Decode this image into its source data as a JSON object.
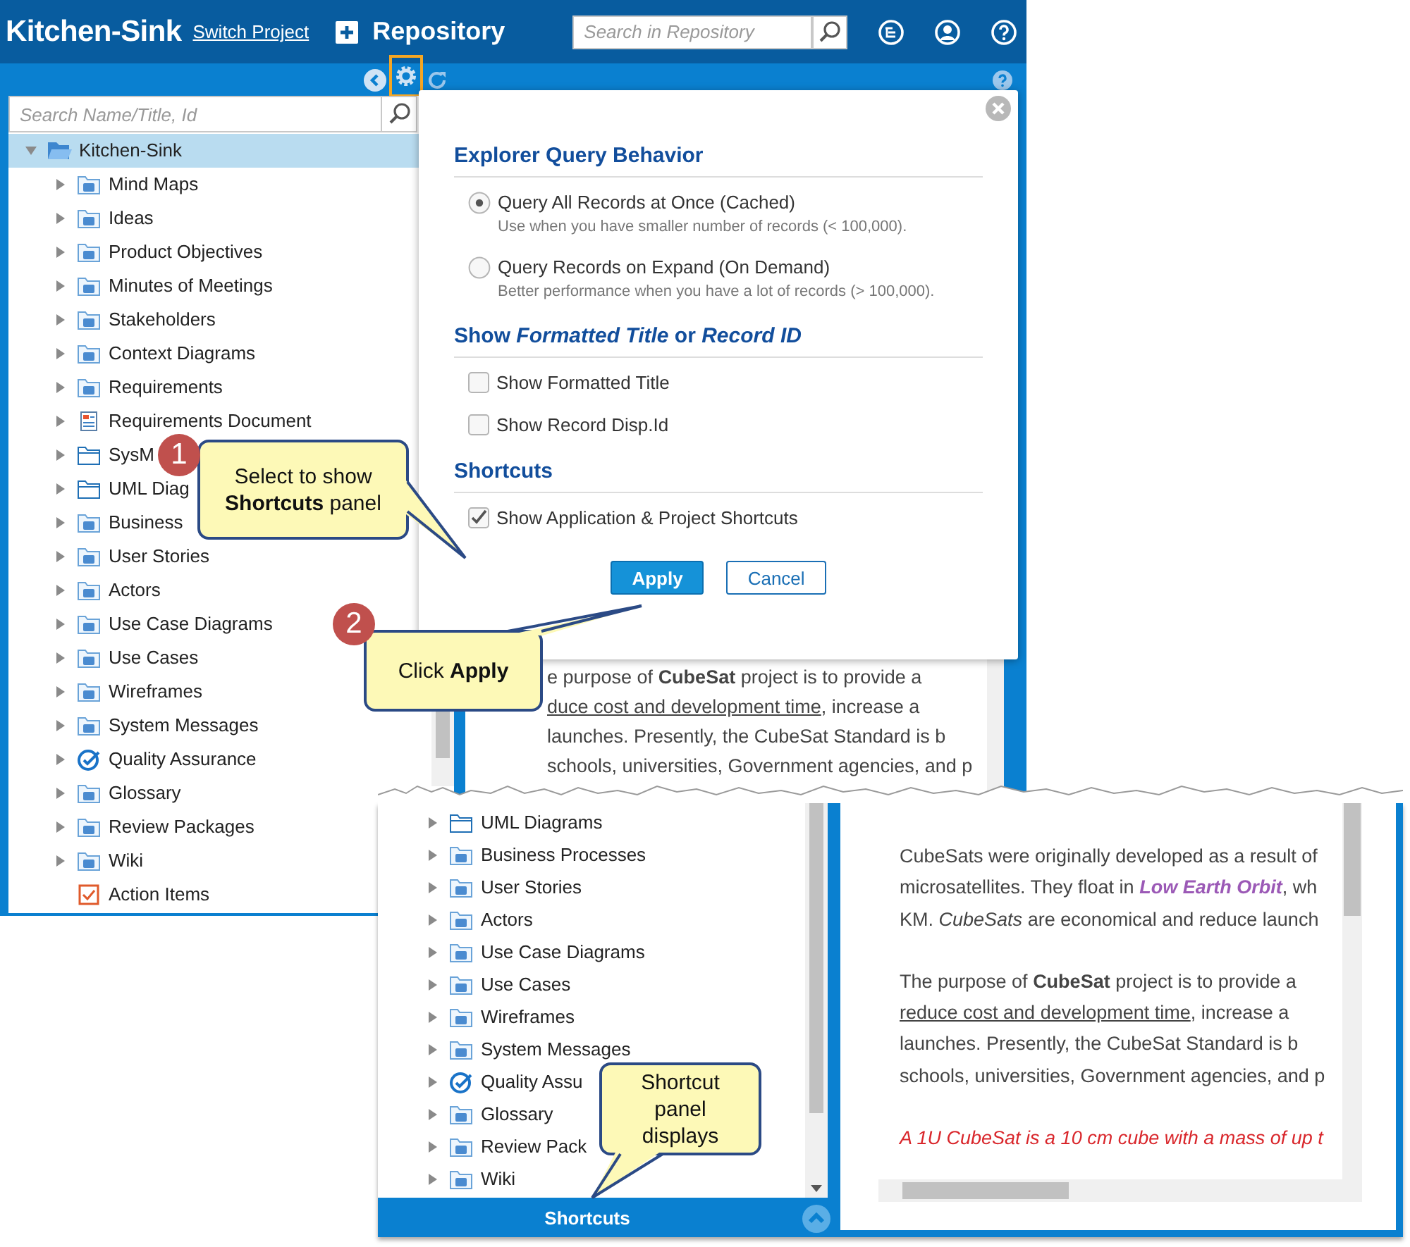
{
  "app": {
    "header": {
      "project": "Kitchen-Sink",
      "switch_link": "Switch Project",
      "section": "Repository",
      "search": {
        "placeholder": "Search in Repository"
      }
    },
    "toolbar": {
      "settings_highlighted": true
    },
    "explorer_search": {
      "placeholder": "Search Name/Title, Id"
    },
    "tree": {
      "label": "Kitchen-Sink",
      "kind": "open-folder",
      "expanded": true,
      "selected": true,
      "children": [
        {
          "label": "Mind Maps",
          "kind": "folder",
          "expanded": false,
          "selected": false
        },
        {
          "label": "Ideas",
          "kind": "folder",
          "expanded": false,
          "selected": false
        },
        {
          "label": "Product Objectives",
          "kind": "folder",
          "expanded": false,
          "selected": false
        },
        {
          "label": "Minutes of Meetings",
          "kind": "folder",
          "expanded": false,
          "selected": false
        },
        {
          "label": "Stakeholders",
          "kind": "folder",
          "expanded": false,
          "selected": false
        },
        {
          "label": "Context Diagrams",
          "kind": "folder",
          "expanded": false,
          "selected": false
        },
        {
          "label": "Requirements",
          "kind": "folder",
          "expanded": false,
          "selected": false
        },
        {
          "label": "Requirements Document",
          "kind": "document",
          "expanded": false,
          "selected": false
        },
        {
          "label": "SysM",
          "kind": "plain-folder",
          "expanded": false,
          "selected": false
        },
        {
          "label": "UML Diag",
          "kind": "plain-folder",
          "expanded": false,
          "selected": false
        },
        {
          "label": "Business",
          "kind": "folder",
          "expanded": false,
          "selected": false
        },
        {
          "label": "User Stories",
          "kind": "folder",
          "expanded": false,
          "selected": false
        },
        {
          "label": "Actors",
          "kind": "folder",
          "expanded": false,
          "selected": false
        },
        {
          "label": "Use Case Diagrams",
          "kind": "folder",
          "expanded": false,
          "selected": false
        },
        {
          "label": "Use Cases",
          "kind": "folder",
          "expanded": false,
          "selected": false
        },
        {
          "label": "Wireframes",
          "kind": "folder",
          "expanded": false,
          "selected": false
        },
        {
          "label": "System Messages",
          "kind": "folder",
          "expanded": false,
          "selected": false
        },
        {
          "label": "Quality Assurance",
          "kind": "check",
          "expanded": false,
          "selected": false
        },
        {
          "label": "Glossary",
          "kind": "folder",
          "expanded": false,
          "selected": false
        },
        {
          "label": "Review Packages",
          "kind": "folder",
          "expanded": false,
          "selected": false
        },
        {
          "label": "Wiki",
          "kind": "folder",
          "expanded": false,
          "selected": false
        },
        {
          "label": "Action Items",
          "kind": "action",
          "selected": false
        }
      ]
    },
    "content_paragraphs": [
      {
        "kind": "body",
        "lines": [
          {
            "segments": [
              {
                "kind": "text",
                "text": "e purpose of **CubeSat** project is to provide a"
              }
            ]
          },
          {
            "segments": [
              {
                "kind": "underlined",
                "text": "duce cost and development time"
              },
              {
                "kind": "text",
                "text": ", increase a"
              }
            ]
          },
          {
            "segments": [
              {
                "kind": "text",
                "text": "launches. Presently, the CubeSat Standard is b"
              }
            ]
          },
          {
            "segments": [
              {
                "kind": "text",
                "text": "schools, universities, Government agencies, and p"
              }
            ]
          }
        ]
      }
    ],
    "dialog": {
      "sections": [
        {
          "title": "Explorer Query Behavior",
          "options": [
            {
              "kind": "radio",
              "label": "Query All Records at Once (Cached)",
              "description": "Use when you have smaller number of records (< 100,000).",
              "selected": true
            },
            {
              "kind": "radio",
              "label": "Query Records on Expand (On Demand)",
              "description": "Better performance when you have a lot of records (> 100,000).",
              "selected": false
            }
          ]
        },
        {
          "title": "Show *Formatted Title* or *Record ID*",
          "options": [
            {
              "kind": "checkbox",
              "label": "Show Formatted Title",
              "checked": false
            },
            {
              "kind": "checkbox",
              "label": "Show Record Disp.Id",
              "checked": false
            }
          ]
        },
        {
          "title": "Shortcuts",
          "options": [
            {
              "kind": "checkbox",
              "label": "Show Application & Project Shortcuts",
              "checked": true
            }
          ]
        }
      ],
      "buttons": [
        {
          "label": "Apply",
          "kind": "primary"
        },
        {
          "label": "Cancel",
          "kind": "secondary"
        }
      ]
    }
  },
  "result": {
    "tree": [
      {
        "label": "UML Diagrams",
        "kind": "plain-folder",
        "expanded": false,
        "selected": false
      },
      {
        "label": "Business Processes",
        "kind": "folder",
        "expanded": false,
        "selected": false
      },
      {
        "label": "User Stories",
        "kind": "folder",
        "expanded": false,
        "selected": false
      },
      {
        "label": "Actors",
        "kind": "folder",
        "expanded": false,
        "selected": false
      },
      {
        "label": "Use Case Diagrams",
        "kind": "folder",
        "expanded": false,
        "selected": false
      },
      {
        "label": "Use Cases",
        "kind": "folder",
        "expanded": false,
        "selected": false
      },
      {
        "label": "Wireframes",
        "kind": "folder",
        "expanded": false,
        "selected": false
      },
      {
        "label": "System Messages",
        "kind": "folder",
        "expanded": false,
        "selected": false
      },
      {
        "label": "Quality Assu",
        "kind": "check",
        "expanded": false,
        "selected": false
      },
      {
        "label": "Glossary",
        "kind": "folder",
        "expanded": false,
        "selected": false
      },
      {
        "label": "Review Pack",
        "kind": "folder",
        "expanded": false,
        "selected": false
      },
      {
        "label": "Wiki",
        "kind": "folder",
        "expanded": false,
        "selected": false
      }
    ],
    "content_paragraphs": [
      {
        "kind": "body",
        "lines": [
          {
            "segments": [
              {
                "kind": "text",
                "text": "CubeSats were originally developed as a result of"
              }
            ]
          },
          {
            "segments": [
              {
                "kind": "text",
                "text": "microsatellites. They float in "
              },
              {
                "kind": "link",
                "text": "Low Earth Orbit"
              },
              {
                "kind": "text",
                "text": ", wh"
              }
            ]
          },
          {
            "segments": [
              {
                "kind": "text",
                "text": "KM. *CubeSats* are economical and reduce launch"
              }
            ]
          }
        ]
      },
      {
        "kind": "body",
        "lines": [
          {
            "segments": [
              {
                "kind": "text",
                "text": "The purpose of **CubeSat** project is to provide a"
              }
            ]
          },
          {
            "segments": [
              {
                "kind": "underlined",
                "text": "reduce cost and development time"
              },
              {
                "kind": "text",
                "text": ", increase a"
              }
            ]
          },
          {
            "segments": [
              {
                "kind": "text",
                "text": "launches. Presently, the CubeSat Standard is b"
              }
            ]
          },
          {
            "segments": [
              {
                "kind": "text",
                "text": "schools, universities, Government agencies, and p"
              }
            ]
          }
        ]
      },
      {
        "kind": "note",
        "lines": [
          {
            "segments": [
              {
                "kind": "text",
                "text": "A 1U CubeSat is a 10 cm cube with a mass of up t"
              }
            ]
          }
        ]
      }
    ],
    "shortcuts_bar": {
      "label": "Shortcuts"
    }
  },
  "callouts": [
    {
      "number": "1",
      "text": "Select to show **Shortcuts** panel"
    },
    {
      "number": "2",
      "text": "Click **Apply**"
    },
    {
      "text": "Shortcut panel displays"
    }
  ]
}
